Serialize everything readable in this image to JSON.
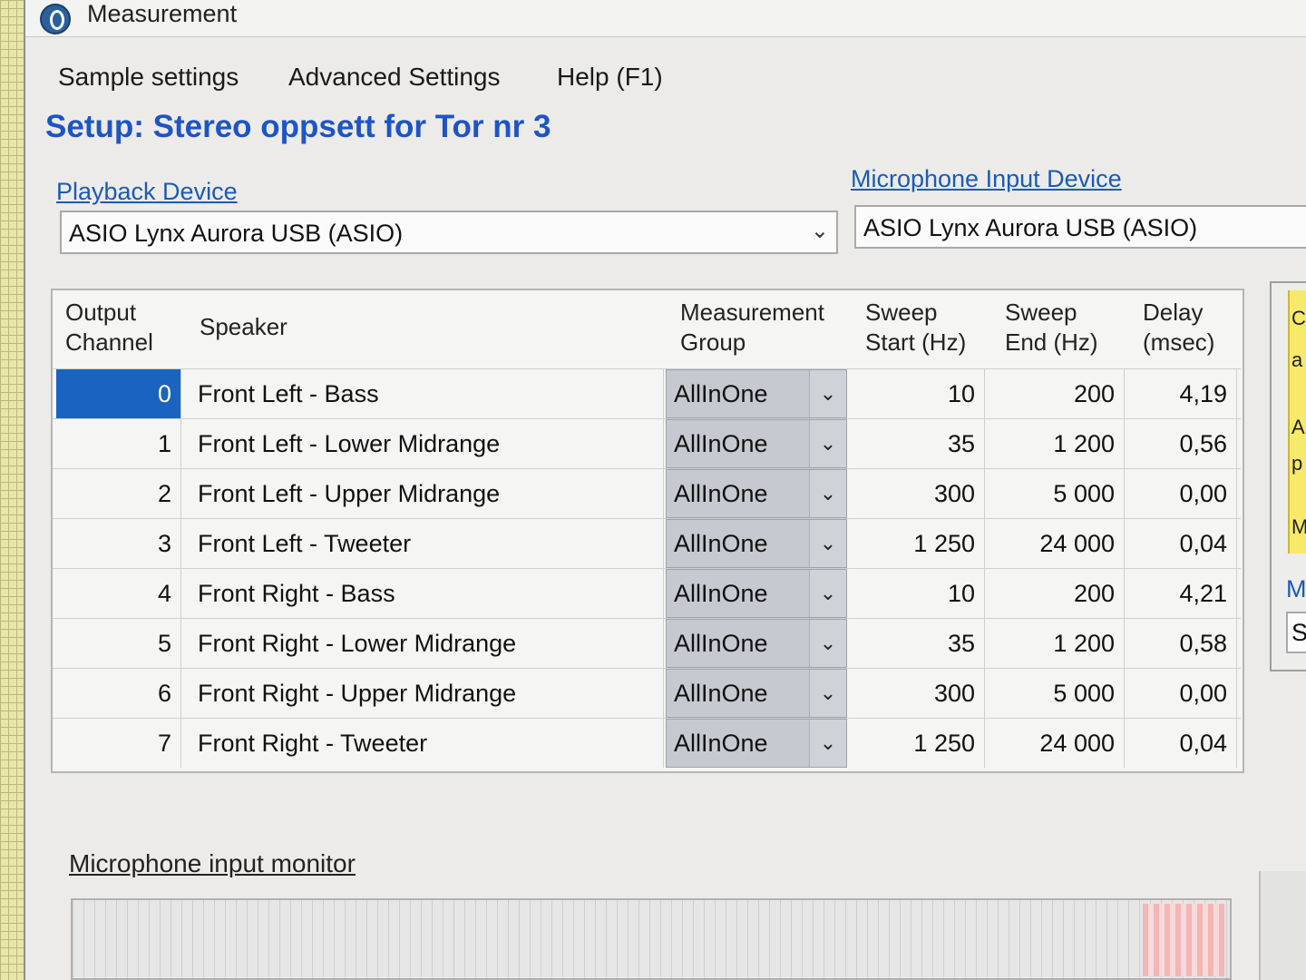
{
  "window": {
    "title": "Measurement"
  },
  "menu": [
    "Sample settings",
    "Advanced Settings",
    "Help (F1)"
  ],
  "setup_title": "Setup: Stereo oppsett for Tor nr 3",
  "playback": {
    "label": "Playback Device",
    "value": "ASIO Lynx Aurora USB (ASIO)"
  },
  "microphone": {
    "label": "Microphone Input Device",
    "value": "ASIO Lynx Aurora USB (ASIO)"
  },
  "grid": {
    "headers": {
      "channel_1": "Output",
      "channel_2": "Channel",
      "speaker": "Speaker",
      "group_1": "Measurement",
      "group_2": "Group",
      "start_1": "Sweep",
      "start_2": "Start (Hz)",
      "end_1": "Sweep",
      "end_2": "End (Hz)",
      "delay_1": "Delay",
      "delay_2": "(msec)"
    },
    "rows": [
      {
        "channel": "0",
        "speaker": "Front Left - Bass",
        "group": "AllInOne",
        "start": "10",
        "end": "200",
        "delay": "4,19"
      },
      {
        "channel": "1",
        "speaker": "Front Left - Lower Midrange",
        "group": "AllInOne",
        "start": "35",
        "end": "1 200",
        "delay": "0,56"
      },
      {
        "channel": "2",
        "speaker": "Front Left - Upper Midrange",
        "group": "AllInOne",
        "start": "300",
        "end": "5 000",
        "delay": "0,00"
      },
      {
        "channel": "3",
        "speaker": "Front Left - Tweeter",
        "group": "AllInOne",
        "start": "1 250",
        "end": "24 000",
        "delay": "0,04"
      },
      {
        "channel": "4",
        "speaker": "Front Right - Bass",
        "group": "AllInOne",
        "start": "10",
        "end": "200",
        "delay": "4,21"
      },
      {
        "channel": "5",
        "speaker": "Front Right - Lower Midrange",
        "group": "AllInOne",
        "start": "35",
        "end": "1 200",
        "delay": "0,58"
      },
      {
        "channel": "6",
        "speaker": "Front Right - Upper Midrange",
        "group": "AllInOne",
        "start": "300",
        "end": "5 000",
        "delay": "0,00"
      },
      {
        "channel": "7",
        "speaker": "Front Right - Tweeter",
        "group": "AllInOne",
        "start": "1 250",
        "end": "24 000",
        "delay": "0,04"
      }
    ],
    "selected_row": 0
  },
  "side_panel": {
    "letters": [
      "C",
      "a",
      "A",
      "p",
      "M"
    ],
    "link_letter": "M",
    "box_letter": "S"
  },
  "mic_monitor_label": "Microphone input monitor",
  "icons": {
    "app": "app-logo-icon",
    "dropdown": "chevron-down-icon"
  },
  "colors": {
    "selection": "#1a63c0",
    "setup_title": "#1d55c7",
    "link": "#1a5ab8"
  }
}
